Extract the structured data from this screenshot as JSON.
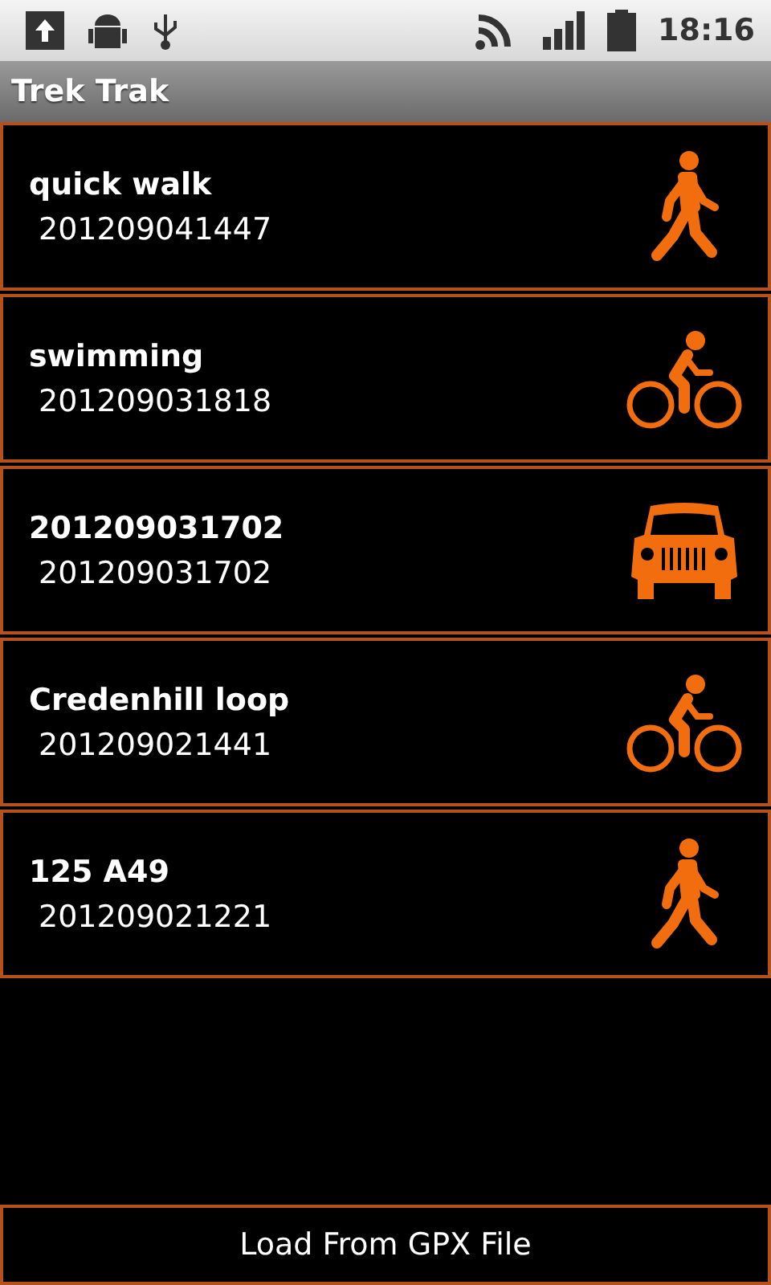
{
  "status_bar": {
    "time": "18:16"
  },
  "window": {
    "title": "Trek Trak"
  },
  "trips": [
    {
      "name": "quick walk",
      "timestamp": "201209041447",
      "kind": "walk"
    },
    {
      "name": "swimming",
      "timestamp": "201209031818",
      "kind": "bike"
    },
    {
      "name": "201209031702",
      "timestamp": "201209031702",
      "kind": "car"
    },
    {
      "name": "Credenhill loop",
      "timestamp": "201209021441",
      "kind": "bike"
    },
    {
      "name": "125 A49",
      "timestamp": "201209021221",
      "kind": "walk"
    }
  ],
  "load_button": {
    "label": "Load From GPX File"
  }
}
